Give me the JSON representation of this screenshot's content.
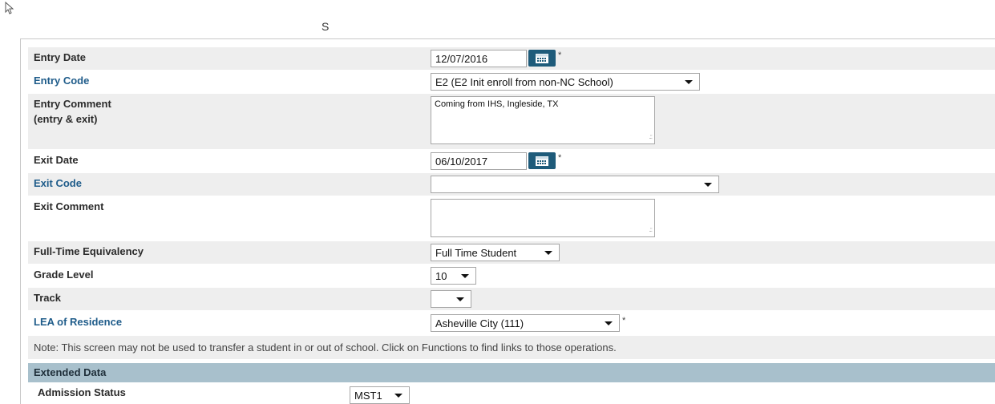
{
  "header": {
    "title": "S"
  },
  "form": {
    "entry_date": {
      "label": "Entry Date",
      "value": "12/07/2016",
      "required_mark": "*"
    },
    "entry_code": {
      "label": "Entry Code",
      "value": "E2 (E2 Init enroll from non-NC School)"
    },
    "entry_comment": {
      "label_line1": "Entry Comment",
      "label_line2": "(entry & exit)",
      "value": "Coming from IHS, Ingleside, TX"
    },
    "exit_date": {
      "label": "Exit Date",
      "value": "06/10/2017",
      "required_mark": "*"
    },
    "exit_code": {
      "label": "Exit Code",
      "value": ""
    },
    "exit_comment": {
      "label": "Exit Comment",
      "value": ""
    },
    "fte": {
      "label": "Full-Time Equivalency",
      "value": "Full Time Student"
    },
    "grade_level": {
      "label": "Grade Level",
      "value": "10"
    },
    "track": {
      "label": "Track",
      "value": ""
    },
    "lea_of_residence": {
      "label": "LEA of Residence",
      "value": "Asheville City (111)",
      "required_mark": "*"
    }
  },
  "note": "Note: This screen may not be used to transfer a student in or out of school. Click on Functions to find links to those operations.",
  "extended_data": {
    "header": "Extended Data",
    "admission_status": {
      "label": "Admission Status",
      "value": "MST1"
    }
  },
  "colors": {
    "link_label": "#1f5c8a",
    "calendar_button": "#1e5b7a",
    "row_gray": "#eeeeee",
    "section_header": "#a8c0cc"
  }
}
